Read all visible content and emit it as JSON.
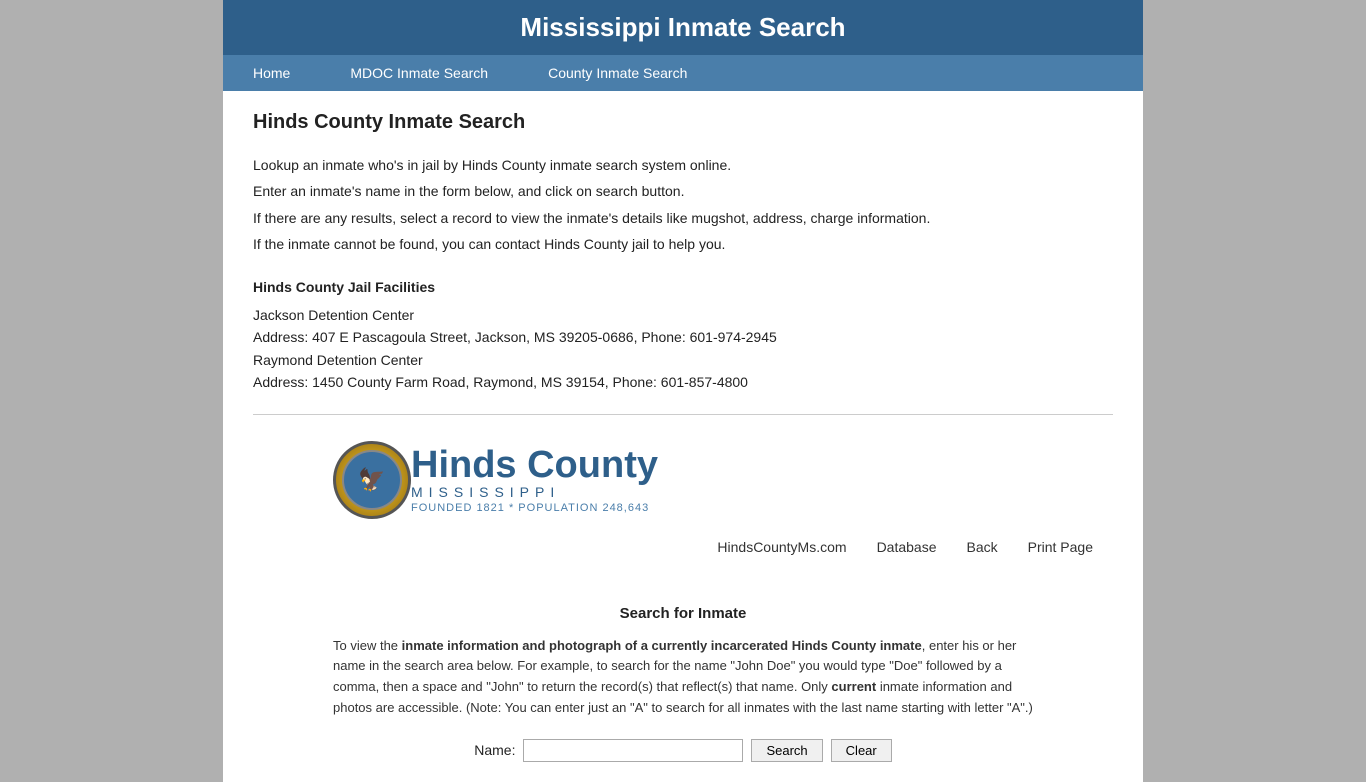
{
  "header": {
    "title": "Mississippi Inmate Search"
  },
  "nav": {
    "items": [
      {
        "label": "Home",
        "href": "#"
      },
      {
        "label": "MDOC Inmate Search",
        "href": "#"
      },
      {
        "label": "County Inmate Search",
        "href": "#"
      }
    ]
  },
  "content": {
    "page_title": "Hinds County Inmate Search",
    "description": {
      "line1": "Lookup an inmate who's in jail by Hinds County inmate search system online.",
      "line2": "Enter an inmate's name in the form below, and click on search button.",
      "line3": "If there are any results, select a record to view the inmate's details like mugshot, address, charge information.",
      "line4": "If the inmate cannot be found, you can contact Hinds County jail to help you."
    },
    "facilities": {
      "title": "Hinds County Jail Facilities",
      "facility1_name": "Jackson Detention Center",
      "facility1_address": "Address: 407 E Pascagoula Street, Jackson, MS 39205-0686, Phone: 601-974-2945",
      "facility2_name": "Raymond Detention Center",
      "facility2_address": "Address: 1450 County Farm Road, Raymond, MS 39154, Phone: 601-857-4800"
    }
  },
  "logo": {
    "county_name": "Hinds County",
    "state": "MISSISSIPPI",
    "founded": "FOUNDED 1821 * POPULATION 248,643"
  },
  "footer_links": [
    {
      "label": "HindsCountyMs.com"
    },
    {
      "label": "Database"
    },
    {
      "label": "Back"
    },
    {
      "label": "Print Page"
    }
  ],
  "search_section": {
    "title": "Search for Inmate",
    "description": "To view the inmate information and photograph of a currently incarcerated Hinds County inmate, enter his or her name in the search area below. For example, to search for the name \"John Doe\" you would type \"Doe\" followed by a comma, then a space and \"John\" to return the record(s) that reflect(s) that name. Only current inmate information and photos are accessible. (Note: You can enter just an \"A\" to search for all inmates with the last name starting with letter \"A\".)",
    "name_label": "Name:",
    "search_button": "Search",
    "clear_button": "Clear",
    "name_placeholder": ""
  }
}
